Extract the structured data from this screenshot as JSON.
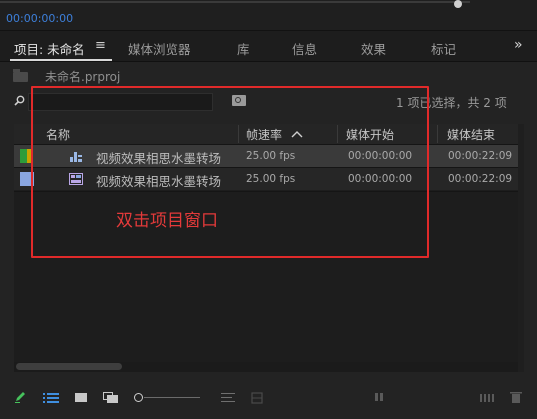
{
  "timeline": {
    "timecode": "00:00:00:00"
  },
  "tabs": [
    {
      "label": "项目: 未命名",
      "active": true
    },
    {
      "label": "媒体浏览器"
    },
    {
      "label": "库"
    },
    {
      "label": "信息"
    },
    {
      "label": "效果"
    },
    {
      "label": "标记"
    }
  ],
  "tab_menu_glyph": "≡",
  "overflow_glyph": "»",
  "project": {
    "file_name": "未命名.prproj"
  },
  "search": {
    "value": "",
    "placeholder": ""
  },
  "selection_status": "1 项已选择，共 2 项",
  "columns": {
    "name": "名称",
    "frame_rate": "帧速率",
    "media_start": "媒体开始",
    "media_end": "媒体结束"
  },
  "items": [
    {
      "label_color": "#2d9c3a",
      "label_color_2": "#c9a400",
      "icon": "sequence-icon",
      "name": "视频效果相思水墨转场",
      "frame_rate": "25.00 fps",
      "media_start": "00:00:00:00",
      "media_end": "00:00:22:09",
      "selected": true
    },
    {
      "label_color": "#8aa6e0",
      "icon": "video-clip-icon",
      "name": "视频效果相思水墨转场",
      "frame_rate": "25.00 fps",
      "media_start": "00:00:00:00",
      "media_end": "00:00:22:09",
      "selected": false
    }
  ],
  "annotation": {
    "text": "双击项目窗口",
    "color": "#e12a2a"
  },
  "colors": {
    "accent": "#3d7fd9",
    "pencil": "#46c25c",
    "background": "#232323"
  }
}
